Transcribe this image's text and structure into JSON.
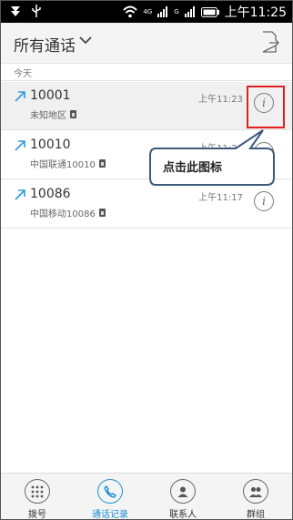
{
  "status_bar": {
    "time": "上午11:25",
    "signal_1": "4G",
    "signal_2": "G"
  },
  "header": {
    "title": "所有通话"
  },
  "section_today": "今天",
  "calls": [
    {
      "number": "10001",
      "subtitle": "未知地区",
      "time": "上午11:23"
    },
    {
      "number": "10010",
      "subtitle": "中国联通10010",
      "time": "上午11:20"
    },
    {
      "number": "10086",
      "subtitle": "中国移动10086",
      "time": "上午11:17"
    }
  ],
  "annotation": {
    "text": "点击此图标",
    "box_color": "#e02020"
  },
  "bottom_nav": [
    {
      "label": "拨号",
      "icon": "dialpad-icon"
    },
    {
      "label": "通话记录",
      "icon": "phone-icon",
      "active": true
    },
    {
      "label": "联系人",
      "icon": "contact-icon"
    },
    {
      "label": "群组",
      "icon": "group-icon"
    }
  ],
  "colors": {
    "accent": "#1a8fd6",
    "outgoing_arrow": "#2a9be0"
  }
}
